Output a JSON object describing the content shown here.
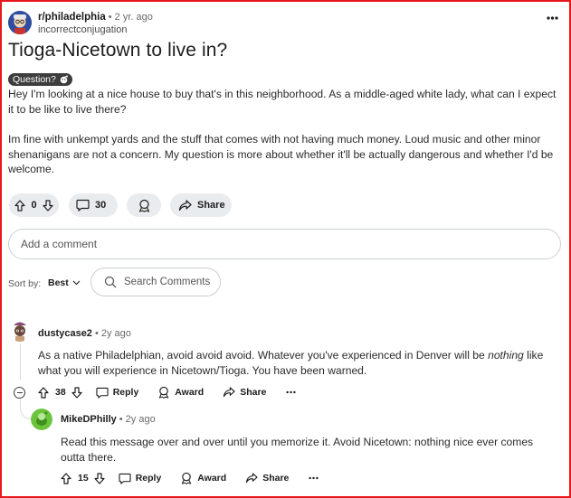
{
  "post": {
    "subreddit": "r/philadelphia",
    "time": "• 2 yr. ago",
    "author": "incorrectconjugation",
    "title": "Tioga-Nicetown to live in?",
    "flair": "Question?",
    "paragraphs": [
      "Hey I'm looking at a nice house to buy that's in this neighborhood. As a middle-aged white lady, what can I expect it to be like to live there?",
      "Im fine with unkempt yards and the stuff that comes with not having much money. Loud music and other minor shenanigans are not a concern. My question is more about whether it'll be actually dangerous and whether I'd be welcome."
    ],
    "votes": "0",
    "comments": "30",
    "share_label": "Share"
  },
  "composer": {
    "placeholder": "Add a comment"
  },
  "sort": {
    "label": "Sort by:",
    "value": "Best"
  },
  "search": {
    "placeholder": "Search Comments"
  },
  "comments": [
    {
      "author": "dustycase2",
      "time": "• 2y ago",
      "text_before": "As a native Philadelphian, avoid avoid avoid. Whatever you've experienced in Denver will be ",
      "text_em": "nothing",
      "text_after": " like what you will experience in Nicetown/Tioga. You have been warned.",
      "votes": "38",
      "reply": "Reply",
      "award": "Award",
      "share": "Share"
    },
    {
      "author": "MikeDPhilly",
      "time": "• 2y ago",
      "text": "Read this message over and over until you memorize it. Avoid Nicetown: nothing nice ever comes outta there.",
      "votes": "15",
      "reply": "Reply",
      "award": "Award",
      "share": "Share"
    }
  ],
  "colors": {
    "frame": "#e8171c",
    "pill": "#e9ecee",
    "avatar_green": "#6cc43c",
    "subreddit_blue": "#2f4ea1"
  },
  "icons": [
    "upvote-icon",
    "downvote-icon",
    "comment-icon",
    "award-icon",
    "share-icon",
    "more-icon",
    "search-icon",
    "chevron-down-icon",
    "collapse-icon"
  ]
}
